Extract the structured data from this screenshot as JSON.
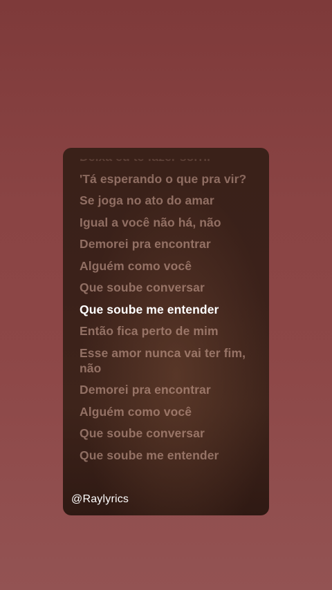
{
  "lyrics": {
    "lines": [
      "Deixa eu te fazer sorrir",
      "'Tá esperando o que pra vir?",
      "Se joga no ato do amar",
      "Igual a você não há, não",
      "Demorei pra encontrar",
      "Alguém como você",
      "Que soube conversar",
      "Que soube me entender",
      "Então fica perto de mim",
      "Esse amor nunca vai ter fim, não",
      "Demorei pra encontrar",
      "Alguém como você",
      "Que soube conversar",
      "Que soube me entender"
    ],
    "active_index": 7
  },
  "watermark": "@Raylyrics",
  "colors": {
    "background": "#8a4444",
    "card": "#3b211a",
    "active_text": "#ffffff",
    "inactive_text": "#c9a194"
  }
}
